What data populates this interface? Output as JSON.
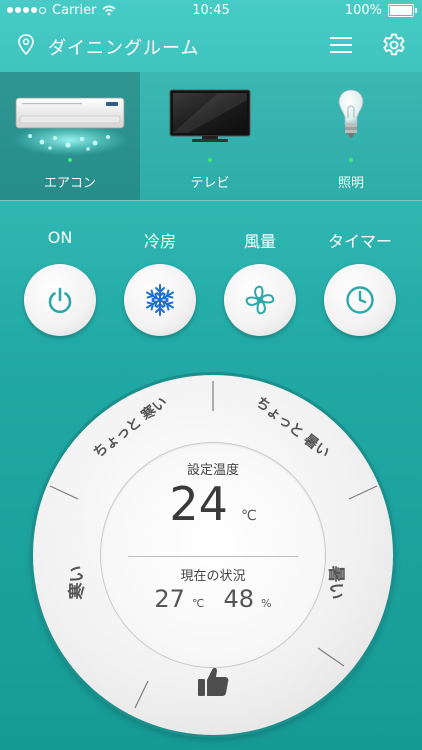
{
  "status_bar": {
    "carrier": "Carrier",
    "time": "10:45",
    "battery": "100%",
    "battery_level": 1.0
  },
  "header": {
    "title": "ダイニングルーム"
  },
  "devices": [
    {
      "label": "エアコン",
      "active": true
    },
    {
      "label": "テレビ",
      "active": false
    },
    {
      "label": "照明",
      "active": false
    }
  ],
  "modes": [
    {
      "label": "ON",
      "icon": "power-icon"
    },
    {
      "label": "冷房",
      "icon": "snowflake-icon"
    },
    {
      "label": "風量",
      "icon": "fan-icon"
    },
    {
      "label": "タイマー",
      "icon": "clock-icon"
    }
  ],
  "dial": {
    "segments": [
      "ちょっと 寒い",
      "ちょっと 暑い",
      "暑い",
      "寒い"
    ],
    "bottom_icon": "thumbs-up-icon",
    "setpoint_label": "設定温度",
    "setpoint_value": "24",
    "setpoint_unit": "℃",
    "status_label": "現在の状況",
    "current_temp": "27",
    "temp_unit": "℃",
    "humidity": "48",
    "humidity_unit": "%"
  },
  "colors": {
    "accent": "#22aaa6",
    "icon_teal": "#2ea7a8",
    "icon_blue": "#1f6fd1"
  }
}
